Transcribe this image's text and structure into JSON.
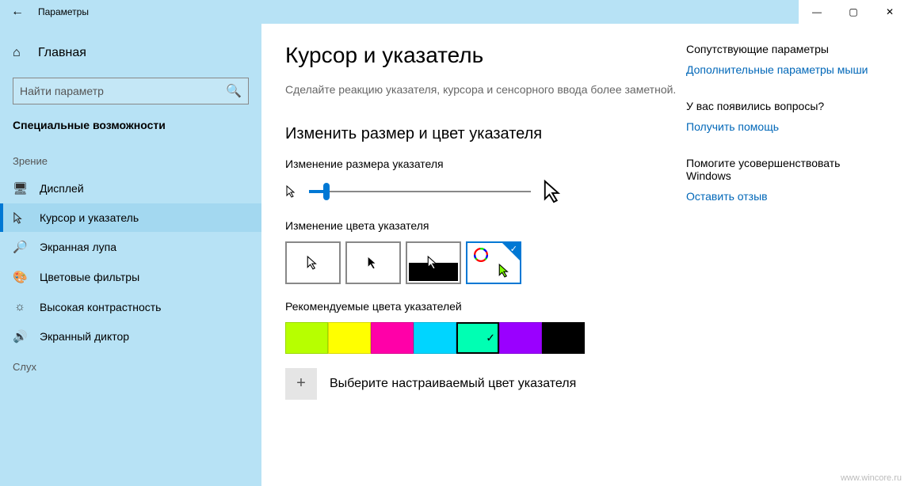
{
  "window": {
    "title": "Параметры"
  },
  "sidebar": {
    "home": "Главная",
    "search_placeholder": "Найти параметр",
    "section": "Специальные возможности",
    "group_vision": "Зрение",
    "group_hearing": "Слух",
    "items": [
      {
        "label": "Дисплей"
      },
      {
        "label": "Курсор и указатель"
      },
      {
        "label": "Экранная лупа"
      },
      {
        "label": "Цветовые фильтры"
      },
      {
        "label": "Высокая контрастность"
      },
      {
        "label": "Экранный диктор"
      }
    ]
  },
  "main": {
    "title": "Курсор и указатель",
    "description": "Сделайте реакцию указателя, курсора и сенсорного ввода более заметной.",
    "section_size_color": "Изменить размер и цвет указателя",
    "label_size": "Изменение размера указателя",
    "label_color": "Изменение цвета указателя",
    "label_recommended": "Рекомендуемые цвета указателей",
    "label_custom": "Выберите настраиваемый цвет указателя",
    "colors": [
      "#b7ff00",
      "#ffff00",
      "#ff00a8",
      "#00d5ff",
      "#00ffb3",
      "#9a00ff",
      "#000000"
    ],
    "selected_color_index": 4
  },
  "right": {
    "related_hd": "Сопутствующие параметры",
    "related_link": "Дополнительные параметры мыши",
    "questions_hd": "У вас появились вопросы?",
    "questions_link": "Получить помощь",
    "improve_hd": "Помогите усовершенствовать Windows",
    "improve_link": "Оставить отзыв"
  },
  "watermark": "www.wincore.ru"
}
